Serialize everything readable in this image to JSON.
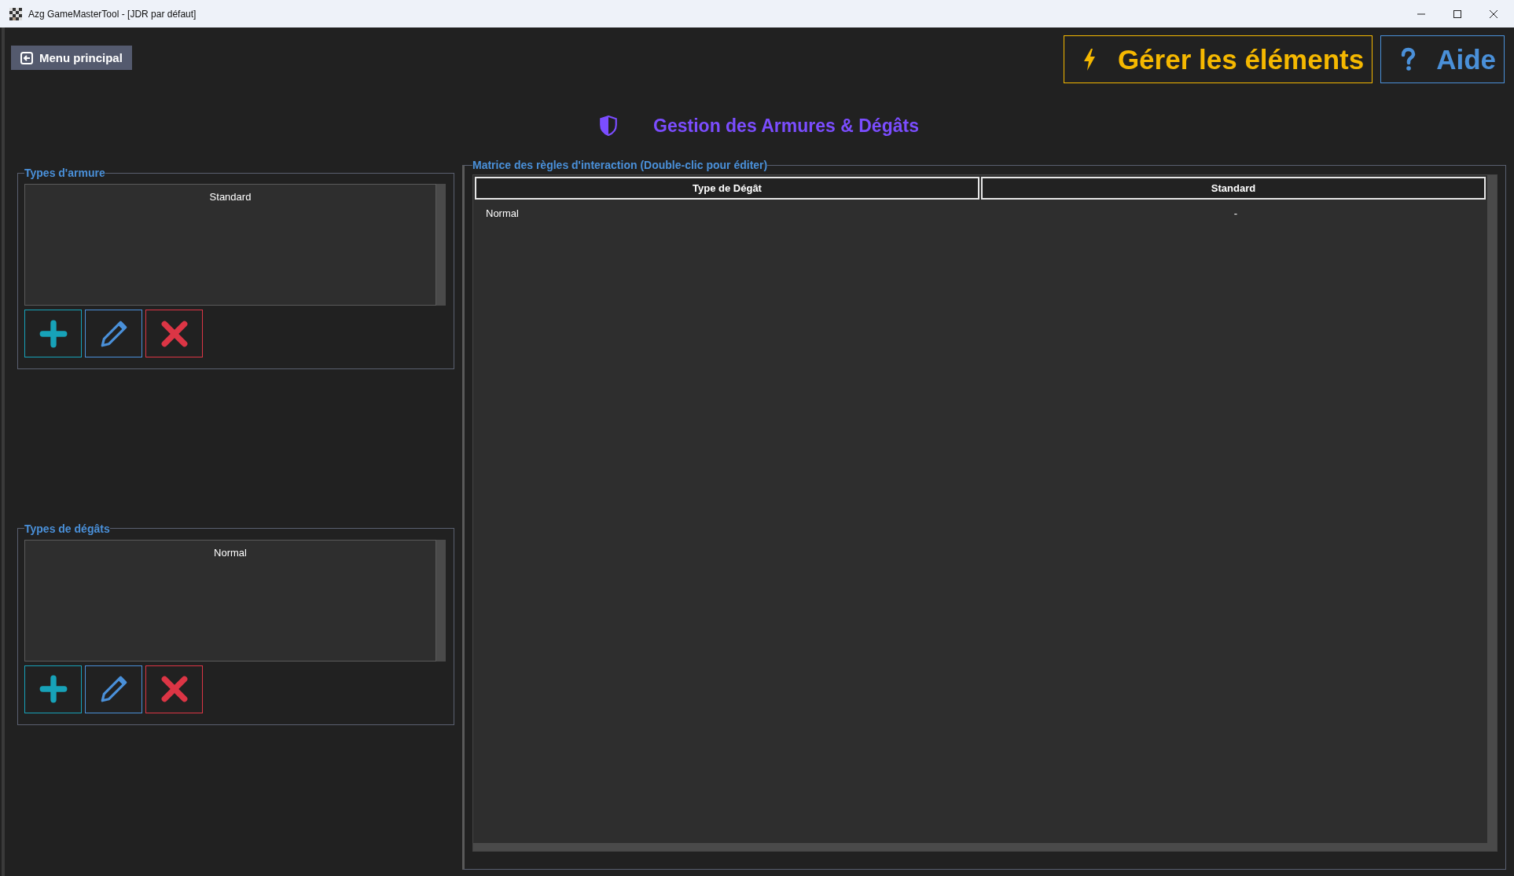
{
  "window": {
    "title": "Azg GameMasterTool - [JDR par défaut]"
  },
  "menu_button": {
    "label": "Menu principal"
  },
  "top_buttons": [
    {
      "kind": "manage",
      "label": "Gérer les éléments"
    },
    {
      "kind": "help",
      "label": "Aide"
    }
  ],
  "heading": "Gestion des Armures & Dégâts",
  "lists": [
    {
      "title": "Types d'armure",
      "items": [
        "Standard"
      ],
      "actions": [
        {
          "kind": "add"
        },
        {
          "kind": "edit"
        },
        {
          "kind": "delete"
        }
      ]
    },
    {
      "title": "Types de dégâts",
      "items": [
        "Normal"
      ],
      "actions": [
        {
          "kind": "add"
        },
        {
          "kind": "edit"
        },
        {
          "kind": "delete"
        }
      ]
    }
  ],
  "matrix": {
    "title": "Matrice des règles d'interaction (Double-clic pour éditer)",
    "columns": [
      "Type de Dégât",
      "Standard"
    ],
    "rows": [
      [
        "Normal",
        "-"
      ]
    ]
  }
}
